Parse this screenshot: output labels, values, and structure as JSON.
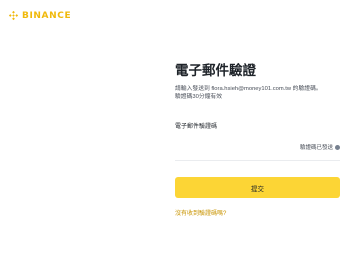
{
  "brand": {
    "name": "BINANCE",
    "color": "#f0b90b"
  },
  "page": {
    "title": "電子郵件驗證",
    "description": "請輸入發送到 flora.hsieh@money101.com.tw 的驗證碼。驗證碼30分鐘有效"
  },
  "code_field": {
    "label": "電子郵件驗證碼",
    "value": "",
    "sent_hint": "驗證碼已發送",
    "hint_icon": "info-icon"
  },
  "submit_button": {
    "label": "提交",
    "color": "#fcd535"
  },
  "help_link": {
    "label": "沒有收到驗證碼嗎?",
    "color": "#c99400"
  }
}
